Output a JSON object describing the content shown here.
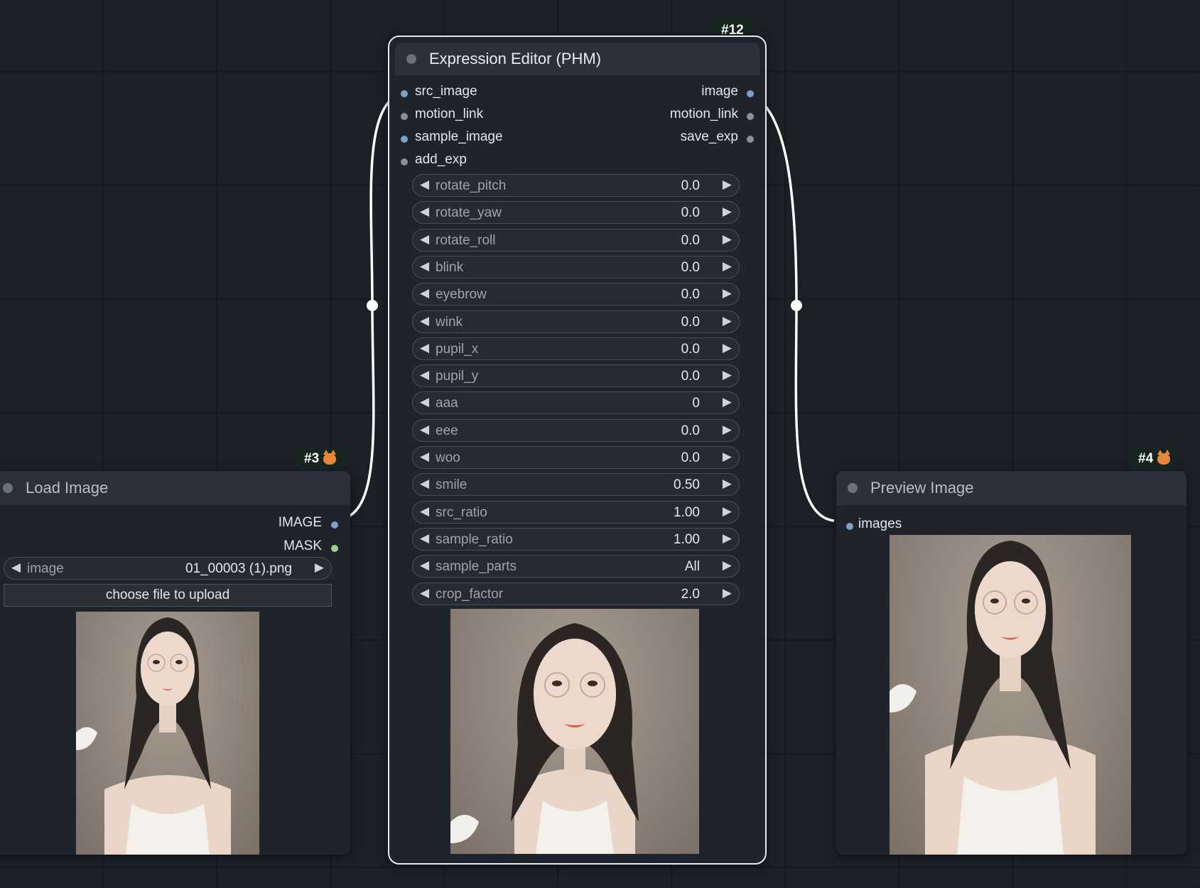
{
  "nodes": {
    "expression_editor": {
      "badge": "#12",
      "title": "Expression Editor (PHM)",
      "inputs": [
        {
          "label": "src_image",
          "color": "#7e9fc8"
        },
        {
          "label": "motion_link",
          "color": "#8a8f99"
        },
        {
          "label": "sample_image",
          "color": "#7e9fc8"
        },
        {
          "label": "add_exp",
          "color": "#8a8f99"
        }
      ],
      "outputs": [
        {
          "label": "image",
          "color": "#7e9fc8"
        },
        {
          "label": "motion_link",
          "color": "#8a8f99"
        },
        {
          "label": "save_exp",
          "color": "#8a8f99"
        }
      ],
      "widgets": [
        {
          "name": "rotate_pitch",
          "value": "0.0"
        },
        {
          "name": "rotate_yaw",
          "value": "0.0"
        },
        {
          "name": "rotate_roll",
          "value": "0.0"
        },
        {
          "name": "blink",
          "value": "0.0"
        },
        {
          "name": "eyebrow",
          "value": "0.0"
        },
        {
          "name": "wink",
          "value": "0.0"
        },
        {
          "name": "pupil_x",
          "value": "0.0"
        },
        {
          "name": "pupil_y",
          "value": "0.0"
        },
        {
          "name": "aaa",
          "value": "0"
        },
        {
          "name": "eee",
          "value": "0.0"
        },
        {
          "name": "woo",
          "value": "0.0"
        },
        {
          "name": "smile",
          "value": "0.50"
        },
        {
          "name": "src_ratio",
          "value": "1.00"
        },
        {
          "name": "sample_ratio",
          "value": "1.00"
        },
        {
          "name": "sample_parts",
          "value": "All"
        },
        {
          "name": "crop_factor",
          "value": "2.0"
        }
      ]
    },
    "load_image": {
      "badge": "#3",
      "title": "Load Image",
      "outputs": [
        {
          "label": "IMAGE",
          "color": "#7e9fc8"
        },
        {
          "label": "MASK",
          "color": "#9fcf8a"
        }
      ],
      "image_widget": {
        "name": "image",
        "value": "01_00003 (1).png"
      },
      "upload_label": "choose file to upload"
    },
    "preview_image": {
      "badge": "#4",
      "title": "Preview Image",
      "inputs": [
        {
          "label": "images",
          "color": "#7e9fc8"
        }
      ]
    }
  },
  "icons": {
    "arrow_left": "◀",
    "arrow_right": "▶"
  }
}
